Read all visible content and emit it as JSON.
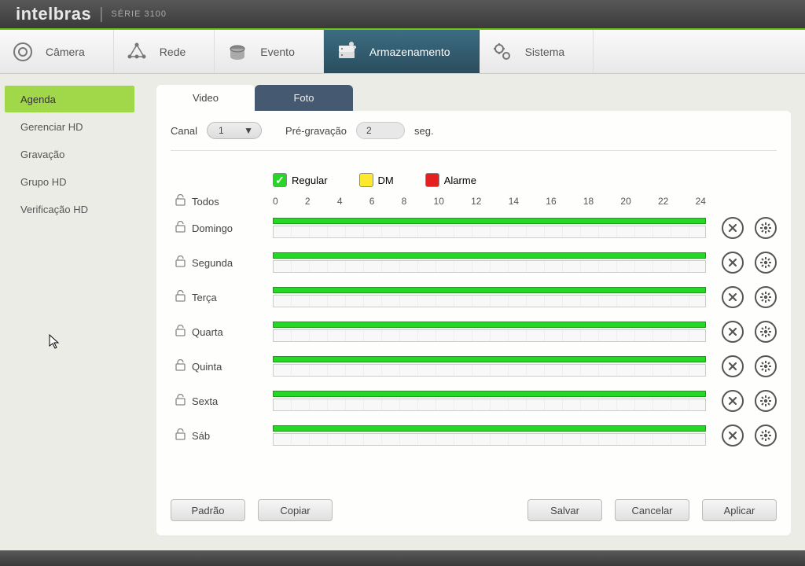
{
  "brand": "intelbras",
  "series": "SÉRIE 3100",
  "nav": [
    {
      "label": "Câmera"
    },
    {
      "label": "Rede"
    },
    {
      "label": "Evento"
    },
    {
      "label": "Armazenamento"
    },
    {
      "label": "Sistema"
    }
  ],
  "sidebar": [
    {
      "label": "Agenda"
    },
    {
      "label": "Gerenciar HD"
    },
    {
      "label": "Gravação"
    },
    {
      "label": "Grupo HD"
    },
    {
      "label": "Verificação HD"
    }
  ],
  "tabs": {
    "video": "Video",
    "foto": "Foto"
  },
  "form": {
    "canal_label": "Canal",
    "canal_value": "1",
    "pregrav_label": "Pré-gravação",
    "pregrav_value": "2",
    "pregrav_unit": "seg."
  },
  "legend": {
    "regular": "Regular",
    "dm": "DM",
    "alarme": "Alarme"
  },
  "hours": [
    "0",
    "2",
    "4",
    "6",
    "8",
    "10",
    "12",
    "14",
    "16",
    "18",
    "20",
    "22",
    "24"
  ],
  "all_label": "Todos",
  "days": [
    "Domingo",
    "Segunda",
    "Terça",
    "Quarta",
    "Quinta",
    "Sexta",
    "Sáb"
  ],
  "buttons": {
    "padrao": "Padrão",
    "copiar": "Copiar",
    "salvar": "Salvar",
    "cancelar": "Cancelar",
    "aplicar": "Aplicar"
  }
}
